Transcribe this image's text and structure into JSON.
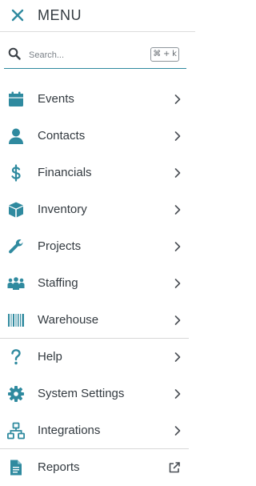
{
  "header": {
    "title": "MENU",
    "close_icon": "close-icon"
  },
  "search": {
    "placeholder": "Search...",
    "shortcut": "⌘ + k",
    "icon": "search-icon"
  },
  "colors": {
    "accent": "#2f8a9f",
    "text": "#333a40",
    "chevron": "#4a4f55",
    "divider": "#d7d7d7"
  },
  "menu": {
    "items": [
      {
        "label": "Events",
        "icon": "calendar-icon",
        "trailing": "chevron-right-icon"
      },
      {
        "label": "Contacts",
        "icon": "person-icon",
        "trailing": "chevron-right-icon"
      },
      {
        "label": "Financials",
        "icon": "dollar-icon",
        "trailing": "chevron-right-icon"
      },
      {
        "label": "Inventory",
        "icon": "box-icon",
        "trailing": "chevron-right-icon"
      },
      {
        "label": "Projects",
        "icon": "wrench-icon",
        "trailing": "chevron-right-icon"
      },
      {
        "label": "Staffing",
        "icon": "people-icon",
        "trailing": "chevron-right-icon"
      },
      {
        "label": "Warehouse",
        "icon": "barcode-icon",
        "trailing": "chevron-right-icon"
      },
      {
        "label": "Help",
        "icon": "question-icon",
        "trailing": "chevron-right-icon"
      },
      {
        "label": "System Settings",
        "icon": "gear-icon",
        "trailing": "chevron-right-icon"
      },
      {
        "label": "Integrations",
        "icon": "network-icon",
        "trailing": "chevron-right-icon"
      },
      {
        "label": "Reports",
        "icon": "document-icon",
        "trailing": "external-link-icon"
      }
    ]
  }
}
